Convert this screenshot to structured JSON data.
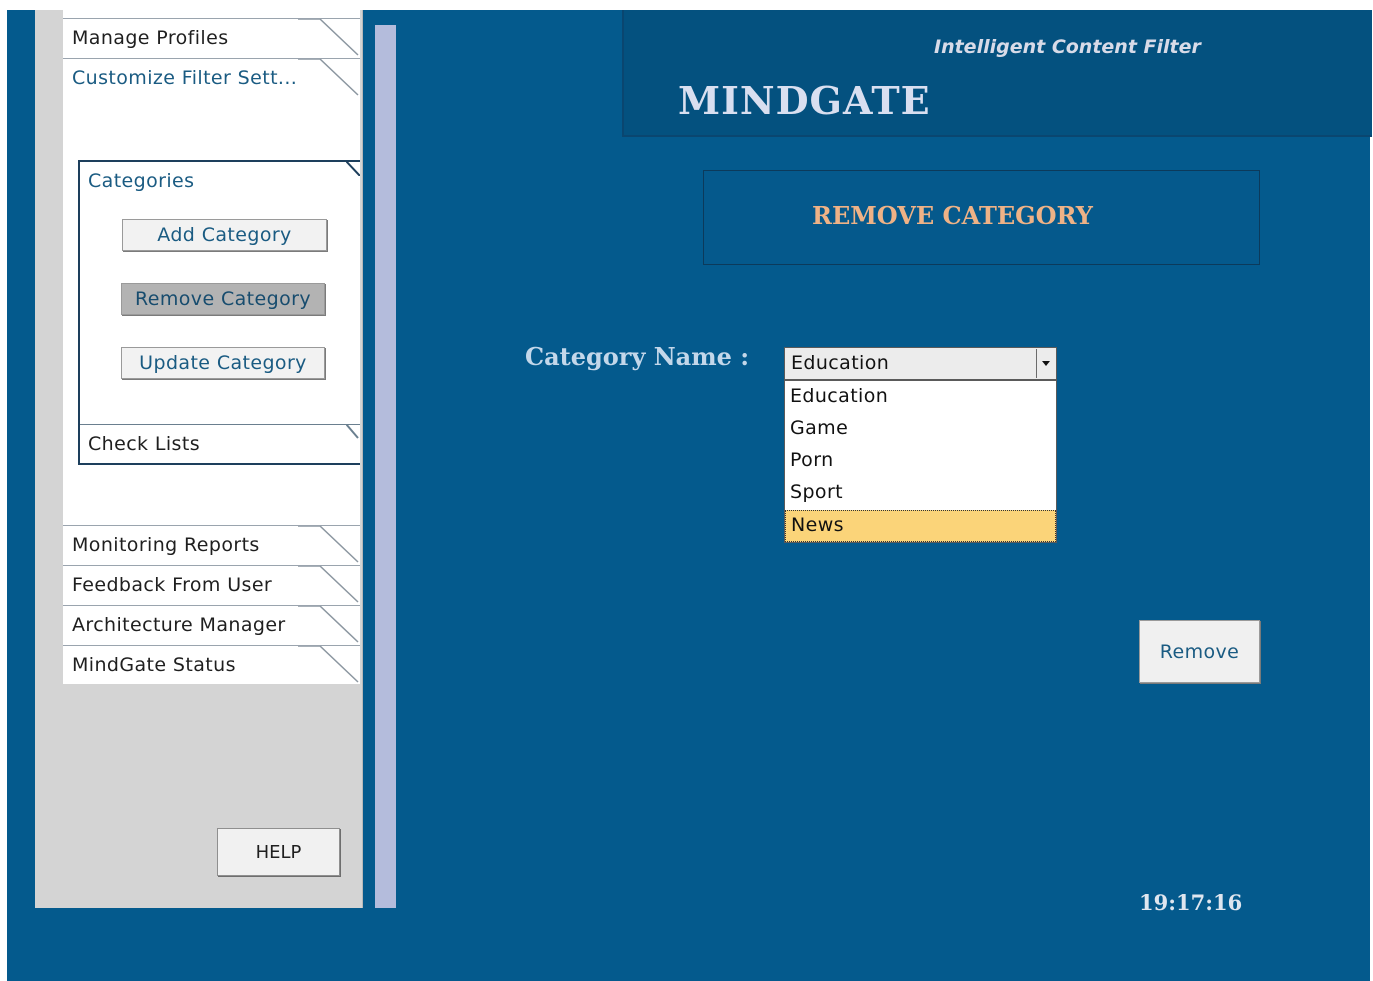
{
  "sidebar": {
    "tabs_top": [
      {
        "label": "Manage Profiles"
      },
      {
        "label": "Customize Filter Sett..."
      }
    ],
    "categories": {
      "title": "Categories",
      "buttons": [
        {
          "label": "Add Category"
        },
        {
          "label": "Remove Category",
          "state": "pressed"
        },
        {
          "label": "Update Category"
        }
      ],
      "checklists_label": "Check Lists"
    },
    "tabs_bottom": [
      {
        "label": "Monitoring Reports"
      },
      {
        "label": "Feedback From User"
      },
      {
        "label": "Architecture Manager"
      },
      {
        "label": "MindGate Status"
      }
    ],
    "help_label": "HELP"
  },
  "header": {
    "subtitle": "Intelligent Content Filter",
    "title": "MINDGATE"
  },
  "main": {
    "section_title": "REMOVE CATEGORY",
    "category_label": "Category Name :",
    "select": {
      "value": "Education",
      "options": [
        "Education",
        "Game",
        "Porn",
        "Sport",
        "News"
      ],
      "highlighted": "News"
    },
    "remove_label": "Remove",
    "clock": "19:17:16"
  },
  "colors": {
    "background": "#045a8d",
    "header_bg": "#04517f",
    "section_title": "#efb286",
    "label": "#c3d7ea",
    "highlight": "#fbd479",
    "divider": "#b4bcdc"
  },
  "icons": {
    "select_arrow": "chevron-down-icon"
  }
}
